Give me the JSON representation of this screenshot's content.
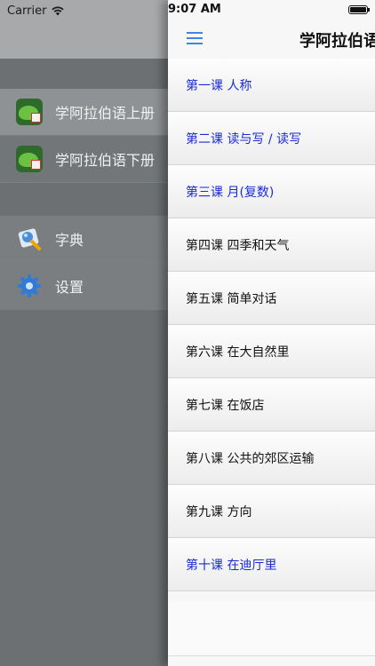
{
  "status_bar": {
    "carrier": "Carrier",
    "time": "9:07 AM"
  },
  "sidebar": {
    "books": [
      {
        "label": "学阿拉伯语上册",
        "icon": "book-volume-1-icon"
      },
      {
        "label": "学阿拉伯语下册",
        "icon": "book-volume-2-icon"
      }
    ],
    "tools": [
      {
        "label": "字典",
        "icon": "dictionary-icon"
      },
      {
        "label": "设置",
        "icon": "gear-icon"
      }
    ]
  },
  "navbar": {
    "title": "学阿拉伯语",
    "menu_icon": "hamburger-menu-icon"
  },
  "lessons": [
    {
      "label": "第一课 人称",
      "done": true
    },
    {
      "label": "第二课 读与写 / 读写",
      "done": true
    },
    {
      "label": "第三课 月(复数)",
      "done": true
    },
    {
      "label": "第四课 四季和天气",
      "done": false
    },
    {
      "label": "第五课 简单对话",
      "done": false
    },
    {
      "label": "第六课 在大自然里",
      "done": false
    },
    {
      "label": "第七课 在饭店",
      "done": false
    },
    {
      "label": "第八课 公共的郊区运输",
      "done": false
    },
    {
      "label": "第九课 方向",
      "done": false
    },
    {
      "label": "第十课 在迪厅里",
      "done": true
    }
  ],
  "colors": {
    "accent": "#3c86e8",
    "done_lesson": "#1a2bd6",
    "sidebar_bg": "#6c7072"
  }
}
